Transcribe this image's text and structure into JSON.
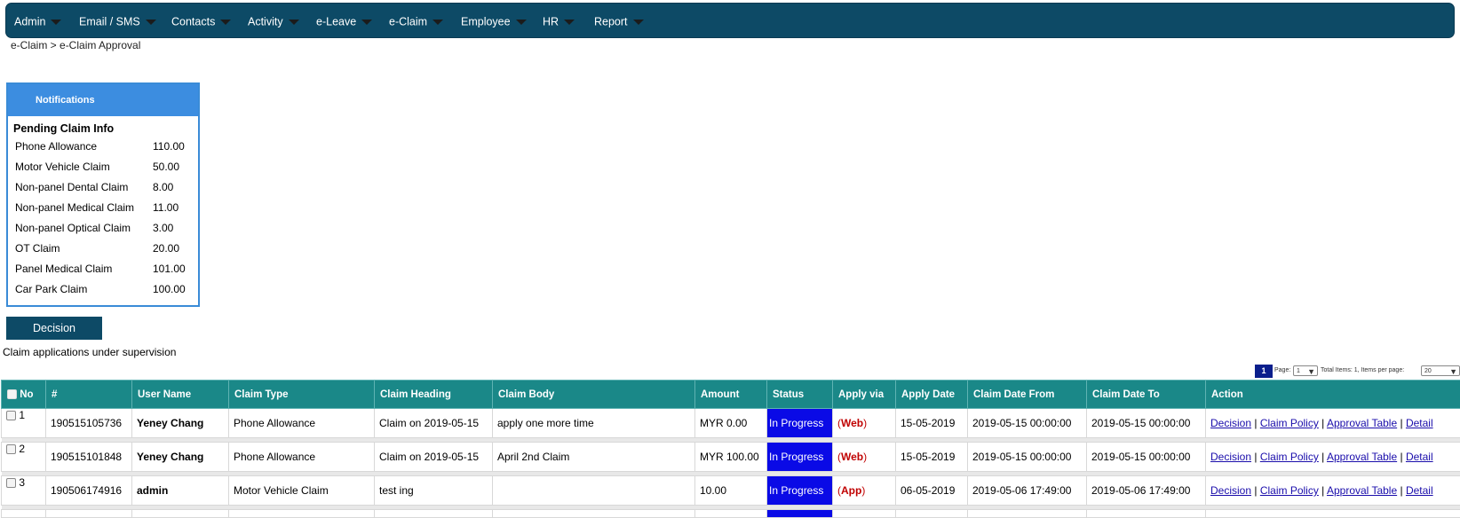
{
  "nav": {
    "items": [
      "Admin",
      "Email / SMS",
      "Contacts",
      "Activity",
      "e-Leave",
      "e-Claim",
      "Employee",
      "HR",
      "Report"
    ]
  },
  "breadcrumb": "e-Claim > e-Claim Approval",
  "notifications": {
    "title": "Notifications",
    "subtitle": "Pending Claim Info",
    "rows": [
      {
        "name": "Phone Allowance",
        "amount": "110.00"
      },
      {
        "name": "Motor Vehicle Claim",
        "amount": "50.00"
      },
      {
        "name": "Non-panel Dental Claim",
        "amount": "8.00"
      },
      {
        "name": "Non-panel Medical Claim",
        "amount": "11.00"
      },
      {
        "name": "Non-panel Optical Claim",
        "amount": "3.00"
      },
      {
        "name": "OT Claim",
        "amount": "20.00"
      },
      {
        "name": "Panel Medical Claim",
        "amount": "101.00"
      },
      {
        "name": "Car Park Claim",
        "amount": "100.00"
      }
    ]
  },
  "decision_button": "Decision",
  "supervision_text": "Claim applications under supervision",
  "pager": {
    "current_page": "1",
    "page_label": "Page:",
    "page_select": "1",
    "total_text": "Total Items: 1, Items per page:",
    "per_page": "20"
  },
  "table": {
    "headers": [
      "No",
      "#",
      "User Name",
      "Claim Type",
      "Claim Heading",
      "Claim Body",
      "Amount",
      "Status",
      "Apply via",
      "Apply Date",
      "Claim Date From",
      "Claim Date To",
      "Action"
    ],
    "rows": [
      {
        "no": "1",
        "id": "190515105736",
        "user": "Yeney Chang",
        "type": "Phone Allowance",
        "heading": "Claim on 2019-05-15",
        "body": "apply one more time",
        "amount": "MYR 0.00",
        "status": "In Progress",
        "via": "Web",
        "apply_date": "15-05-2019",
        "from": "2019-05-15 00:00:00",
        "to": "2019-05-15 00:00:00"
      },
      {
        "no": "2",
        "id": "190515101848",
        "user": "Yeney Chang",
        "type": "Phone Allowance",
        "heading": "Claim on 2019-05-15",
        "body": "April 2nd Claim",
        "amount": "MYR 100.00",
        "status": "In Progress",
        "via": "Web",
        "apply_date": "15-05-2019",
        "from": "2019-05-15 00:00:00",
        "to": "2019-05-15 00:00:00"
      },
      {
        "no": "3",
        "id": "190506174916",
        "user": "admin",
        "type": "Motor Vehicle Claim",
        "heading": "test ing",
        "body": "",
        "amount": "10.00",
        "status": "In Progress",
        "via": "App",
        "apply_date": "06-05-2019",
        "from": "2019-05-06 17:49:00",
        "to": "2019-05-06 17:49:00"
      }
    ],
    "actions": {
      "decision": "Decision",
      "policy": "Claim Policy",
      "approval": "Approval Table",
      "detail": "Detail"
    }
  },
  "colors": {
    "nav": "#0d4a66",
    "header": "#1a8888",
    "status": "#0a0ae6",
    "notif_head": "#3c8de0"
  }
}
